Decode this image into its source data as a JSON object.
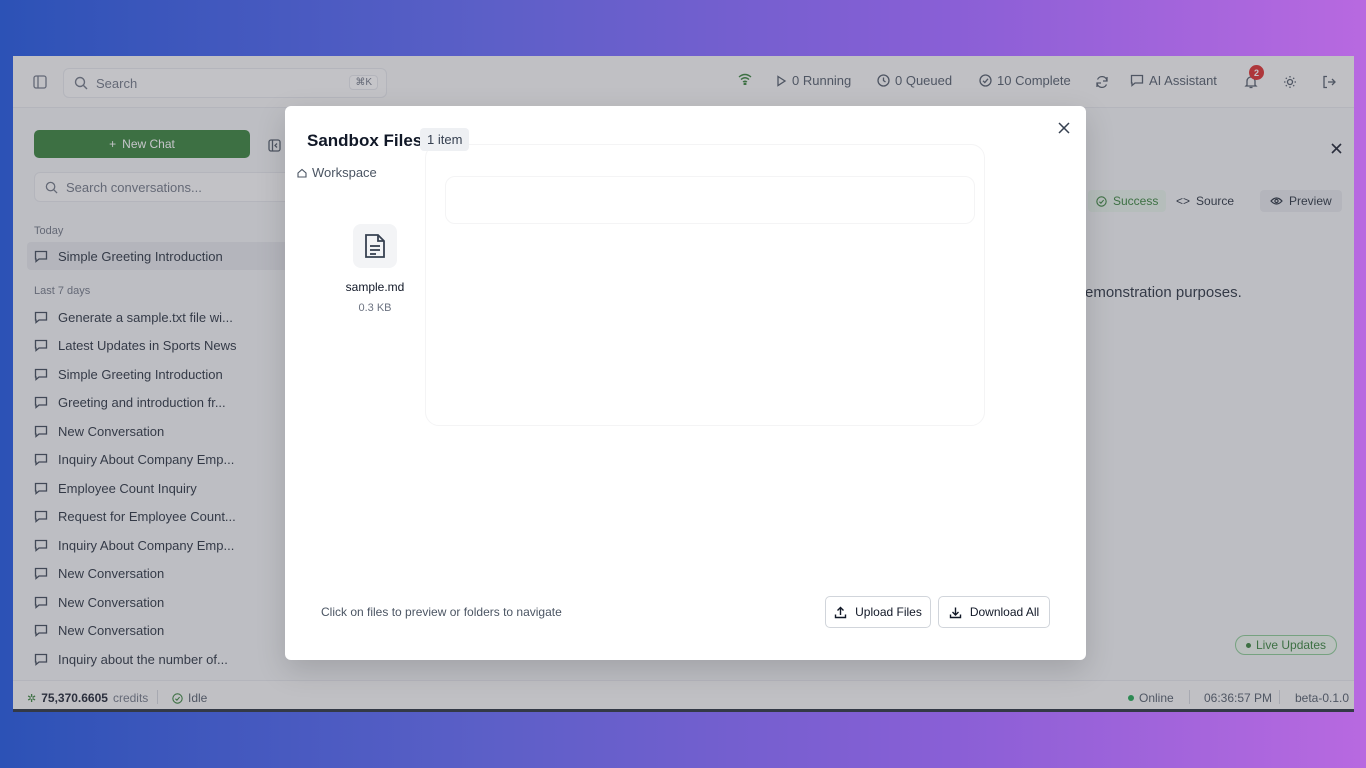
{
  "topbar": {
    "search_placeholder": "Search",
    "search_shortcut": "⌘K",
    "running": "0 Running",
    "queued": "0 Queued",
    "complete": "10 Complete",
    "assistant": "AI Assistant",
    "notifications": "2"
  },
  "sidebar": {
    "new_chat": "New Chat",
    "search_placeholder": "Search conversations...",
    "today_label": "Today",
    "today_items": [
      "Simple Greeting Introduction"
    ],
    "week_label": "Last 7 days",
    "week_items": [
      "Generate a sample.txt file wi...",
      "Latest Updates in Sports News",
      "Simple Greeting Introduction",
      "Greeting and introduction fr...",
      "New Conversation",
      "Inquiry About Company Emp...",
      "Employee Count Inquiry",
      "Request for Employee Count...",
      "Inquiry About Company Emp...",
      "New Conversation",
      "New Conversation",
      "New Conversation",
      "Inquiry about the number of..."
    ]
  },
  "panel": {
    "success": "Success",
    "source": "Source",
    "preview": "Preview",
    "body_text": "emonstration purposes.",
    "live_updates": "Live Updates"
  },
  "bottombar": {
    "credits_value": "75,370.6605",
    "credits_label": "credits",
    "state": "Idle",
    "online": "Online",
    "time": "06:36:57 PM",
    "version": "beta-0.1.0"
  },
  "modal": {
    "title": "Sandbox Files",
    "count": "1 item",
    "breadcrumb": "Workspace",
    "file": {
      "name": "sample.md",
      "size": "0.3 KB"
    },
    "hint": "Click on files to preview or folders to navigate",
    "upload": "Upload Files",
    "download": "Download All"
  },
  "colors": {
    "brand_green": "#2e7d32",
    "notification_red": "#dc2626"
  }
}
